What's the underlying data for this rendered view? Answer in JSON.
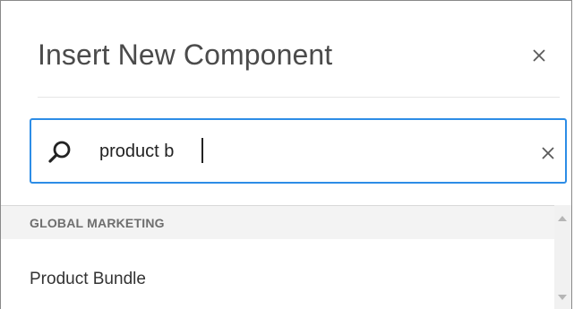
{
  "dialog": {
    "title": "Insert New Component",
    "close_icon": "close-icon"
  },
  "search": {
    "value": "product b",
    "placeholder": "",
    "search_icon": "search-icon",
    "clear_icon": "clear-icon"
  },
  "results": {
    "groups": [
      {
        "label": "GLOBAL MARKETING",
        "items": [
          {
            "label": "Product Bundle"
          }
        ]
      }
    ]
  },
  "colors": {
    "focus_border": "#2d8de6",
    "group_header_bg": "#f3f3f3",
    "title_text": "#4b4b4b"
  }
}
